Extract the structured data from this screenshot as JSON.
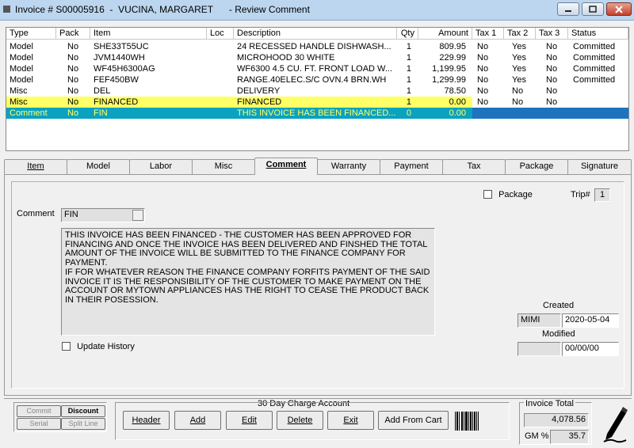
{
  "window": {
    "title": "Invoice # S00005916  -  VUCINA, MARGARET      - Review Comment"
  },
  "grid": {
    "columns": [
      "Type",
      "Pack",
      "Item",
      "Loc",
      "Description",
      "Qty",
      "Amount",
      "Tax 1",
      "Tax 2",
      "Tax 3",
      "Status"
    ],
    "rows": [
      {
        "type": "Model",
        "pack": "No",
        "item": "SHE33T55UC",
        "loc": "",
        "desc": "24 RECESSED HANDLE DISHWASH...",
        "qty": "1",
        "amount": "809.95",
        "tax1": "No",
        "tax2": "Yes",
        "tax3": "No",
        "status": "Committed"
      },
      {
        "type": "Model",
        "pack": "No",
        "item": "JVM1440WH",
        "loc": "",
        "desc": "MICROHOOD 30 WHITE",
        "qty": "1",
        "amount": "229.99",
        "tax1": "No",
        "tax2": "Yes",
        "tax3": "No",
        "status": "Committed"
      },
      {
        "type": "Model",
        "pack": "No",
        "item": "WF45H6300AG",
        "loc": "",
        "desc": "WF6300 4.5 CU. FT. FRONT LOAD W...",
        "qty": "1",
        "amount": "1,199.95",
        "tax1": "No",
        "tax2": "Yes",
        "tax3": "No",
        "status": "Committed"
      },
      {
        "type": "Model",
        "pack": "No",
        "item": "FEF450BW",
        "loc": "",
        "desc": "RANGE.40ELEC.S/C OVN.4 BRN.WH",
        "qty": "1",
        "amount": "1,299.99",
        "tax1": "No",
        "tax2": "Yes",
        "tax3": "No",
        "status": "Committed"
      },
      {
        "type": "Misc",
        "pack": "No",
        "item": "DEL",
        "loc": "",
        "desc": "DELIVERY",
        "qty": "1",
        "amount": "78.50",
        "tax1": "No",
        "tax2": "No",
        "tax3": "No",
        "status": ""
      },
      {
        "type": "Misc",
        "pack": "No",
        "item": "FINANCED",
        "loc": "",
        "desc": "FINANCED",
        "qty": "1",
        "amount": "0.00",
        "tax1": "No",
        "tax2": "No",
        "tax3": "No",
        "status": ""
      },
      {
        "type": "Comment",
        "pack": "No",
        "item": "FIN",
        "loc": "",
        "desc": "THIS INVOICE HAS BEEN FINANCED...",
        "qty": "0",
        "amount": "0.00",
        "tax1": "",
        "tax2": "",
        "tax3": "",
        "status": ""
      }
    ]
  },
  "tabs": [
    "Item",
    "Model",
    "Labor",
    "Misc",
    "Comment",
    "Warranty",
    "Payment",
    "Tax",
    "Package",
    "Signature"
  ],
  "comment_tab": {
    "package_label": "Package",
    "trip_label": "Trip#",
    "trip_value": "1",
    "comment_label": "Comment",
    "comment_code": "FIN",
    "comment_text": "THIS INVOICE HAS BEEN FINANCED - THE CUSTOMER HAS BEEN APPROVED FOR FINANCING AND ONCE THE INVOICE HAS BEEN DELIVERED AND FINSHED THE TOTAL AMOUNT OF THE INVOICE WILL BE SUBMITTED TO THE FINANCE COMPANY FOR PAYMENT.\nIF FOR WHATEVER REASON THE FINANCE COMPANY FORFITS PAYMENT OF THE SAID INVOICE IT IS THE RESPONSIBILITY OF THE CUSTOMER TO MAKE PAYMENT ON THE ACCOUNT OR MYTOWN APPLIANCES HAS THE RIGHT TO CEASE THE PRODUCT BACK IN THEIR POSESSION.",
    "update_history_label": "Update History",
    "created_label": "Created",
    "created_user": "MIMI",
    "created_date": "2020-05-04",
    "modified_label": "Modified",
    "modified_user": "",
    "modified_date": "00/00/00"
  },
  "footer": {
    "commit": "Commit",
    "discount": "Discount",
    "serial": "Serial",
    "split_line": "Split Line",
    "account_label": "30 Day Charge Account",
    "header": "Header",
    "add": "Add",
    "edit": "Edit",
    "delete": "Delete",
    "exit": "Exit",
    "add_from_cart": "Add From Cart",
    "invoice_total_label": "Invoice Total",
    "invoice_total": "4,078.56",
    "gm_label": "GM %",
    "gm_value": "35.7"
  }
}
